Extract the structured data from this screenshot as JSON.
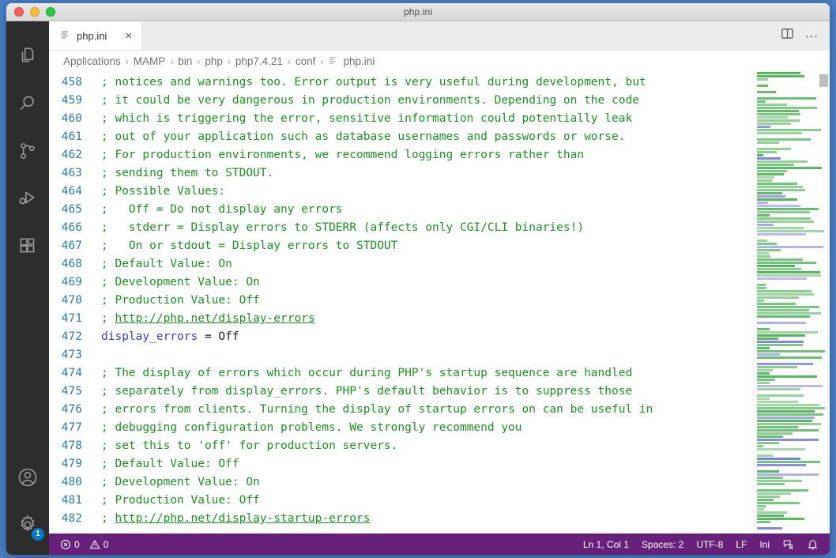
{
  "window": {
    "title": "php.ini"
  },
  "traffic": {
    "close": "close-window",
    "minimize": "minimize-window",
    "maximize": "maximize-window"
  },
  "activitybar": {
    "items": [
      {
        "name": "explorer-icon",
        "label": "Explorer"
      },
      {
        "name": "search-icon",
        "label": "Search"
      },
      {
        "name": "source-control-icon",
        "label": "Source Control"
      },
      {
        "name": "run-and-debug-icon",
        "label": "Run and Debug"
      },
      {
        "name": "extensions-icon",
        "label": "Extensions"
      }
    ],
    "account": {
      "name": "account-icon",
      "label": "Accounts"
    },
    "settings": {
      "name": "settings-gear-icon",
      "label": "Manage",
      "badge": "1"
    }
  },
  "tabs": [
    {
      "label": "php.ini",
      "icon": "ini-file-icon",
      "close": "×",
      "active": true
    }
  ],
  "editor_actions": {
    "split_editor": "split-editor-icon",
    "more_actions": "∙∙∙"
  },
  "breadcrumb": {
    "separator": "›",
    "items": [
      "Applications",
      "MAMP",
      "bin",
      "php",
      "php7.4.21",
      "conf"
    ],
    "file": "php.ini"
  },
  "colors": {
    "accent": "#68217a",
    "comment": "#1a9321",
    "keyword": "#3b3bcd",
    "linenumber": "#2b7ab0",
    "badge": "#007acc",
    "activitybar": "#2d2d2d"
  },
  "code": {
    "first_line_number": 458,
    "lines": [
      {
        "n": 458,
        "tokens": [
          {
            "t": "comment",
            "v": "; notices and warnings too. Error output is very useful during development, but"
          }
        ]
      },
      {
        "n": 459,
        "tokens": [
          {
            "t": "comment",
            "v": "; it could be very dangerous in production environments. Depending on the code"
          }
        ]
      },
      {
        "n": 460,
        "tokens": [
          {
            "t": "comment",
            "v": "; which is triggering the error, sensitive information could potentially leak"
          }
        ]
      },
      {
        "n": 461,
        "tokens": [
          {
            "t": "comment",
            "v": "; out of your application such as database usernames and passwords or worse."
          }
        ]
      },
      {
        "n": 462,
        "tokens": [
          {
            "t": "comment",
            "v": "; For production environments, we recommend logging errors rather than"
          }
        ]
      },
      {
        "n": 463,
        "tokens": [
          {
            "t": "comment",
            "v": "; sending them to STDOUT."
          }
        ]
      },
      {
        "n": 464,
        "tokens": [
          {
            "t": "comment",
            "v": "; Possible Values:"
          }
        ]
      },
      {
        "n": 465,
        "tokens": [
          {
            "t": "comment",
            "v": ";   Off = Do not display any errors"
          }
        ]
      },
      {
        "n": 466,
        "tokens": [
          {
            "t": "comment",
            "v": ";   stderr = Display errors to STDERR (affects only CGI/CLI binaries!)"
          }
        ]
      },
      {
        "n": 467,
        "tokens": [
          {
            "t": "comment",
            "v": ";   On or stdout = Display errors to STDOUT"
          }
        ]
      },
      {
        "n": 468,
        "tokens": [
          {
            "t": "comment",
            "v": "; Default Value: On"
          }
        ]
      },
      {
        "n": 469,
        "tokens": [
          {
            "t": "comment",
            "v": "; Development Value: On"
          }
        ]
      },
      {
        "n": 470,
        "tokens": [
          {
            "t": "comment",
            "v": "; Production Value: Off"
          }
        ]
      },
      {
        "n": 471,
        "tokens": [
          {
            "t": "comment",
            "v": "; "
          },
          {
            "t": "link",
            "v": "http://php.net/display-errors"
          }
        ]
      },
      {
        "n": 472,
        "tokens": [
          {
            "t": "key",
            "v": "display_errors"
          },
          {
            "t": "plain",
            "v": " = Off"
          }
        ]
      },
      {
        "n": 473,
        "tokens": [
          {
            "t": "plain",
            "v": ""
          }
        ]
      },
      {
        "n": 474,
        "tokens": [
          {
            "t": "comment",
            "v": "; The display of errors which occur during PHP's startup sequence are handled"
          }
        ]
      },
      {
        "n": 475,
        "tokens": [
          {
            "t": "comment",
            "v": "; separately from display_errors. PHP's default behavior is to suppress those"
          }
        ]
      },
      {
        "n": 476,
        "tokens": [
          {
            "t": "comment",
            "v": "; errors from clients. Turning the display of startup errors on can be useful in"
          }
        ]
      },
      {
        "n": 477,
        "tokens": [
          {
            "t": "comment",
            "v": "; debugging configuration problems. We strongly recommend you"
          }
        ]
      },
      {
        "n": 478,
        "tokens": [
          {
            "t": "comment",
            "v": "; set this to 'off' for production servers."
          }
        ]
      },
      {
        "n": 479,
        "tokens": [
          {
            "t": "comment",
            "v": "; Default Value: Off"
          }
        ]
      },
      {
        "n": 480,
        "tokens": [
          {
            "t": "comment",
            "v": "; Development Value: On"
          }
        ]
      },
      {
        "n": 481,
        "tokens": [
          {
            "t": "comment",
            "v": "; Production Value: Off"
          }
        ]
      },
      {
        "n": 482,
        "tokens": [
          {
            "t": "comment",
            "v": "; "
          },
          {
            "t": "link",
            "v": "http://php.net/display-startup-errors"
          }
        ]
      }
    ]
  },
  "statusbar": {
    "problems": {
      "errors_icon": "error-circle-icon",
      "errors": "0",
      "warnings_icon": "warning-triangle-icon",
      "warnings": "0"
    },
    "cursor": "Ln 1, Col 1",
    "indentation": "Spaces: 2",
    "encoding": "UTF-8",
    "eol": "LF",
    "language": "Ini",
    "feedback_icon": "feedback-smiley-icon",
    "notifications_icon": "bell-icon"
  }
}
